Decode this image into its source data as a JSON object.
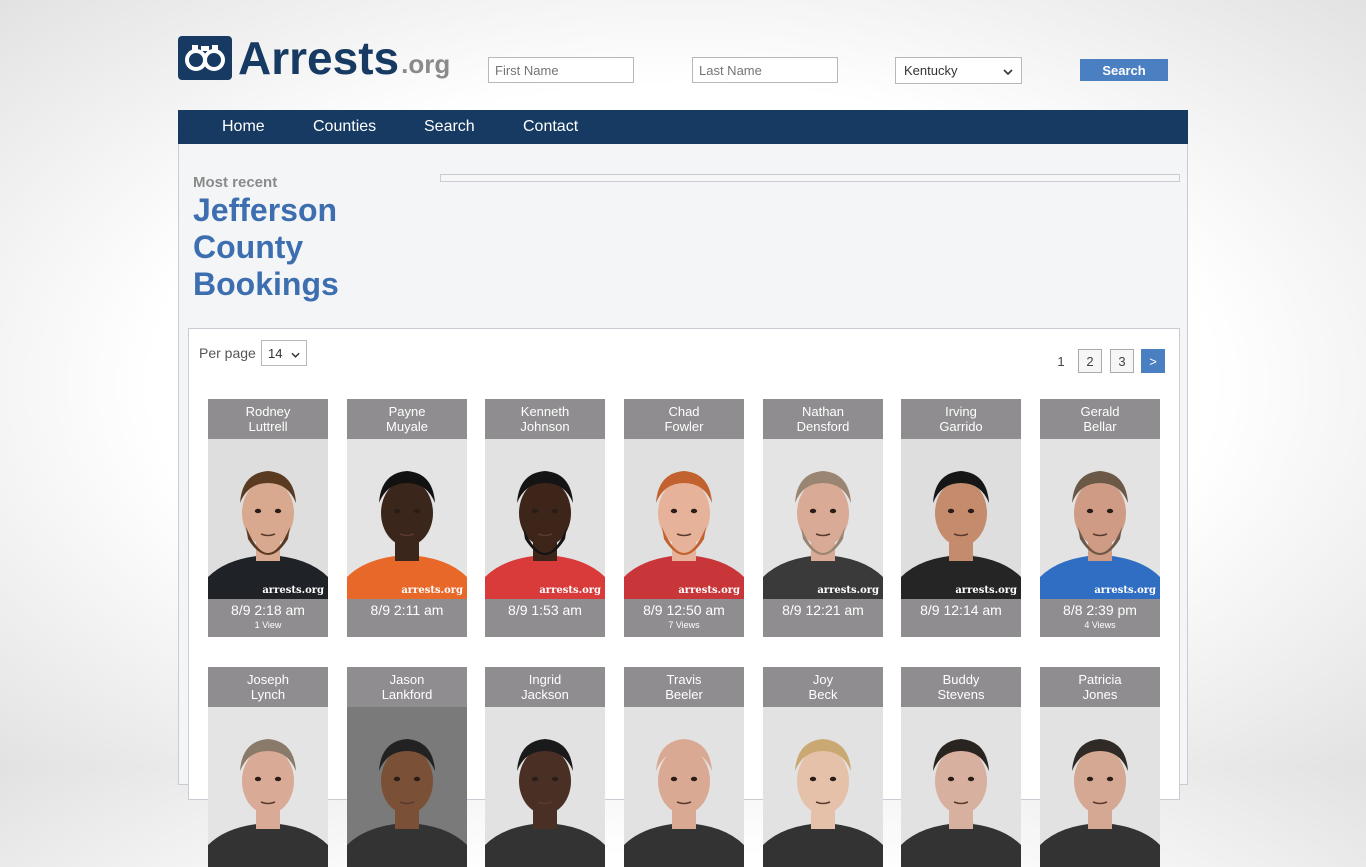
{
  "logo": {
    "main": "Arrests",
    "tld": ".org"
  },
  "search": {
    "first_placeholder": "First Name",
    "last_placeholder": "Last Name",
    "state": "Kentucky",
    "button": "Search"
  },
  "nav": [
    "Home",
    "Counties",
    "Search",
    "Contact"
  ],
  "heading": {
    "kicker": "Most recent",
    "title": "Jefferson County Bookings"
  },
  "perpage": {
    "label": "Per page",
    "value": "14"
  },
  "pagination": {
    "current": "1",
    "pages": [
      "2",
      "3"
    ],
    "next": ">"
  },
  "watermark": "arrests.org",
  "bookings": [
    {
      "first": "Rodney",
      "last": "Luttrell",
      "time": "8/9 2:18 am",
      "views": "1 View",
      "shirt": "#1f2226",
      "skin": "#d8a98e",
      "hair": "#5a3b22",
      "beard": true,
      "bg": "#dedede"
    },
    {
      "first": "Payne",
      "last": "Muyale",
      "time": "8/9 2:11 am",
      "views": "",
      "shirt": "#e8682a",
      "skin": "#3b261b",
      "hair": "#111111",
      "beard": false,
      "bg": "#e4e4e4"
    },
    {
      "first": "Kenneth",
      "last": "Johnson",
      "time": "8/9 1:53 am",
      "views": "",
      "shirt": "#d93a3a",
      "skin": "#3d2519",
      "hair": "#141414",
      "beard": true,
      "bg": "#e2e2e2"
    },
    {
      "first": "Chad",
      "last": "Fowler",
      "time": "8/9 12:50 am",
      "views": "7 Views",
      "shirt": "#c8363a",
      "skin": "#e7b29a",
      "hair": "#c2622e",
      "beard": true,
      "bg": "#e0e0e0"
    },
    {
      "first": "Nathan",
      "last": "Densford",
      "time": "8/9 12:21 am",
      "views": "",
      "shirt": "#3a3a3a",
      "skin": "#d9aa95",
      "hair": "#9a8572",
      "beard": true,
      "bg": "#e4e4e4"
    },
    {
      "first": "Irving",
      "last": "Garrido",
      "time": "8/9 12:14 am",
      "views": "",
      "shirt": "#252525",
      "skin": "#c48c6c",
      "hair": "#161616",
      "beard": false,
      "bg": "#dedede"
    },
    {
      "first": "Gerald",
      "last": "Bellar",
      "time": "8/8 2:39 pm",
      "views": "4 Views",
      "shirt": "#2f6ec2",
      "skin": "#cf9b84",
      "hair": "#6b5846",
      "beard": true,
      "bg": "#e3e3e3"
    },
    {
      "first": "Joseph",
      "last": "Lynch",
      "time": "",
      "views": "",
      "shirt": "#333333",
      "skin": "#d9ab96",
      "hair": "#8a7a6a",
      "beard": false,
      "bg": "#e4e4e4"
    },
    {
      "first": "Jason",
      "last": "Lankford",
      "time": "",
      "views": "",
      "shirt": "#333333",
      "skin": "#7a5036",
      "hair": "#222222",
      "beard": false,
      "bg": "#7a7a7a"
    },
    {
      "first": "Ingrid",
      "last": "Jackson",
      "time": "",
      "views": "",
      "shirt": "#333333",
      "skin": "#4a3024",
      "hair": "#1a1a1a",
      "beard": false,
      "bg": "#e2e2e2"
    },
    {
      "first": "Travis",
      "last": "Beeler",
      "time": "",
      "views": "",
      "shirt": "#333333",
      "skin": "#d9a993",
      "hair": "#d9a993",
      "beard": false,
      "bg": "#e2e2e2"
    },
    {
      "first": "Joy",
      "last": "Beck",
      "time": "",
      "views": "",
      "shirt": "#333333",
      "skin": "#e4c1a8",
      "hair": "#c9a871",
      "beard": false,
      "bg": "#e2e2e2"
    },
    {
      "first": "Buddy",
      "last": "Stevens",
      "time": "",
      "views": "",
      "shirt": "#333333",
      "skin": "#d8b0a0",
      "hair": "#2a2420",
      "beard": false,
      "bg": "#e2e2e2"
    },
    {
      "first": "Patricia",
      "last": "Jones",
      "time": "",
      "views": "",
      "shirt": "#333333",
      "skin": "#d4a892",
      "hair": "#2f2a25",
      "beard": false,
      "bg": "#e2e2e2"
    }
  ],
  "colors": {
    "brand": "#173a63",
    "accent": "#4a7fc1",
    "card_gray": "#8f8d8f",
    "title_blue": "#3d6fb0"
  }
}
